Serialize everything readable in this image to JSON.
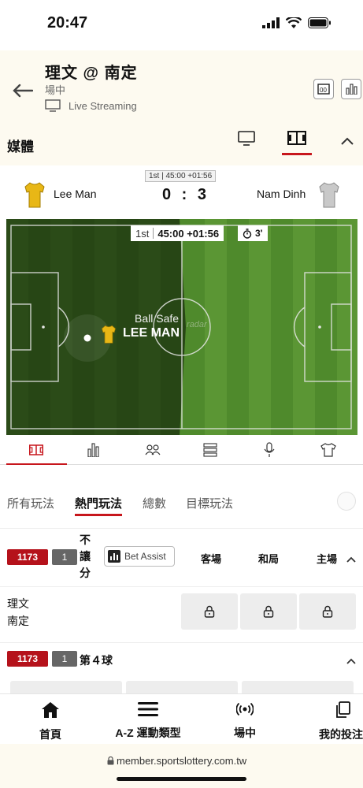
{
  "status_bar": {
    "time": "20:47"
  },
  "header": {
    "title": "理文 @ 南定",
    "status": "場中",
    "live_label": "Live Streaming"
  },
  "media": {
    "label": "媒體"
  },
  "scoreboard": {
    "period": "1st | 45:00 +01:56",
    "home_team": "Lee Man",
    "away_team": "Nam Dinh",
    "score": "0 : 3"
  },
  "pitch": {
    "period_label": "1st",
    "clock": "45:00 +01:56",
    "stoppage": "3'",
    "event_title": "Ball Safe",
    "event_team": "LEE MAN",
    "watermark": "radar"
  },
  "bet_tabs": {
    "all": "所有玩法",
    "hot": "熱門玩法",
    "total": "總數",
    "goal": "目標玩法"
  },
  "market1": {
    "event_id": "1173",
    "market_no": "1",
    "label": "不讓分",
    "bet_assist": "Bet Assist",
    "col_away": "客場",
    "col_draw": "和局",
    "col_home": "主場"
  },
  "odds_row": {
    "team1": "理文",
    "team2": "南定"
  },
  "market2": {
    "event_id": "1173",
    "market_no": "1",
    "label": "第４球"
  },
  "bottom_nav": {
    "home": "首頁",
    "sports": "A-Z 運動類型",
    "live": "場中",
    "mybets": "我的投注"
  },
  "url": "member.sportslottery.com.tw",
  "colors": {
    "accent": "#c7161c",
    "badge_red": "#b5121b",
    "header_bg": "#fdfaf0"
  }
}
